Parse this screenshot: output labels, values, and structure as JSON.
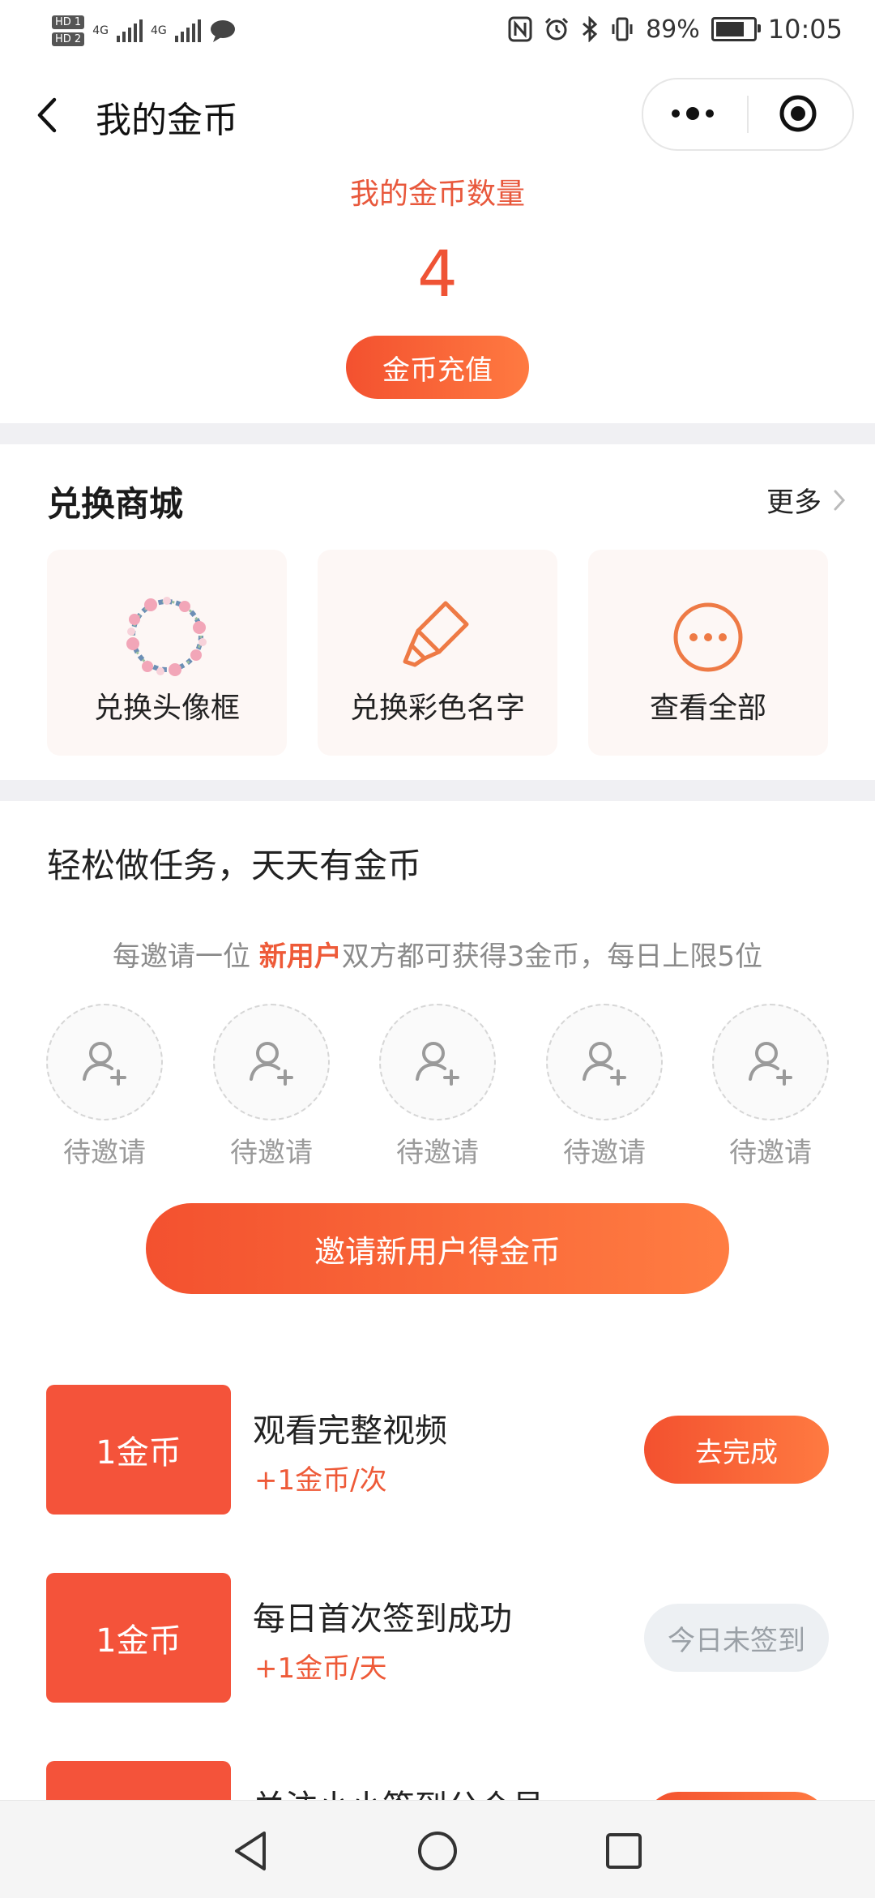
{
  "status_bar": {
    "hd1": "HD 1",
    "hd2": "HD 2",
    "net1": "4G",
    "net2": "4G",
    "battery_text": "89%",
    "battery_level": 0.89,
    "time": "10:05",
    "icons": [
      "nfc-icon",
      "alarm-icon",
      "bluetooth-icon",
      "vibrate-icon"
    ]
  },
  "nav": {
    "title": "我的金币"
  },
  "balance": {
    "label": "我的金币数量",
    "value": "4",
    "recharge_label": "金币充值"
  },
  "shop": {
    "title": "兑换商城",
    "more_label": "更多",
    "items": [
      {
        "label": "兑换头像框",
        "icon": "flower-wreath-icon"
      },
      {
        "label": "兑换彩色名字",
        "icon": "highlighter-icon"
      },
      {
        "label": "查看全部",
        "icon": "more-circle-icon"
      }
    ]
  },
  "tasks": {
    "heading": "轻松做任务，天天有金币",
    "invite_note_pre": "每邀请一位 ",
    "invite_note_hl": "新用户",
    "invite_note_post": "双方都可获得3金币，每日上限5位",
    "slots": [
      "待邀请",
      "待邀请",
      "待邀请",
      "待邀请",
      "待邀请"
    ],
    "invite_button": "邀请新用户得金币",
    "list": [
      {
        "badge": "1金币",
        "name": "观看完整视频",
        "reward": "+1金币/次",
        "action": "去完成",
        "enabled": true
      },
      {
        "badge": "1金币",
        "name": "每日首次签到成功",
        "reward": "+1金币/天",
        "action": "今日未签到",
        "enabled": false
      },
      {
        "badge": "",
        "name": "关注小小签到公众号",
        "reward": "",
        "action": "",
        "enabled": true
      }
    ]
  },
  "colors": {
    "accent": "#f4533a",
    "accent_light": "#ff7a41",
    "page_gap": "#f0f0f3"
  }
}
